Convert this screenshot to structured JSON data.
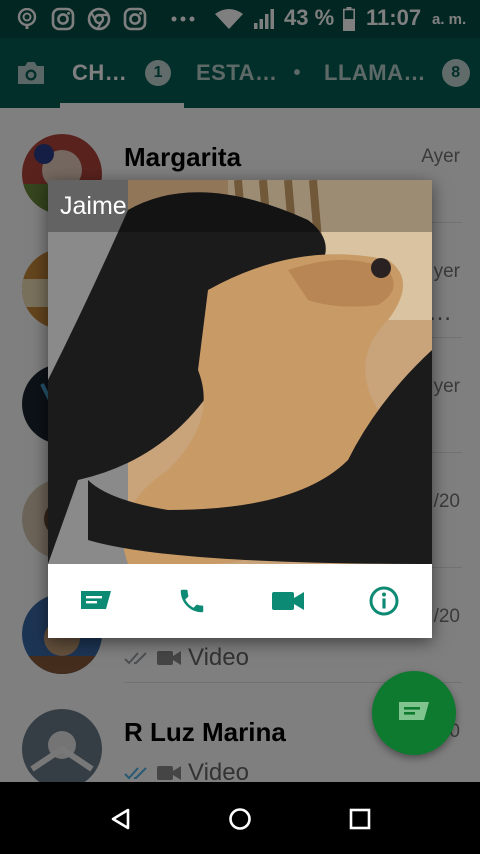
{
  "status_bar": {
    "battery_percent": "43 %",
    "time": "11:07",
    "ampm": "a. m.",
    "left_icons": [
      "radar-icon",
      "instagram-icon",
      "chrome-icon",
      "instagram-icon",
      "more-dots-icon"
    ],
    "right_icons": [
      "wifi-icon",
      "signal-icon",
      "battery-icon"
    ]
  },
  "tabs": [
    {
      "label": "CH…",
      "badge": "1",
      "active": true
    },
    {
      "label": "ESTA…",
      "badge": "•",
      "active": false
    },
    {
      "label": "LLAMA…",
      "badge": "8",
      "active": false
    }
  ],
  "chats": [
    {
      "name": "Margarita",
      "time": "Ayer",
      "preview": "",
      "ticks": false
    },
    {
      "name": "",
      "time": "yer",
      "preview": "…",
      "ticks": false
    },
    {
      "name": "",
      "time": "yer",
      "preview": "",
      "ticks": false
    },
    {
      "name": "",
      "time": "/20",
      "preview": "",
      "ticks": false
    },
    {
      "name": "",
      "time": "/20",
      "preview": "Video",
      "ticks": true,
      "ticks_color": "#9aa0a6"
    },
    {
      "name": "R Luz Marina",
      "time": "0",
      "preview": "Video",
      "ticks": true,
      "ticks_color": "#4fb3e8"
    }
  ],
  "popup": {
    "contact_name": "Jaime",
    "actions": [
      {
        "name": "message-icon",
        "color": "#0d8a74"
      },
      {
        "name": "phone-icon",
        "color": "#0d8a74"
      },
      {
        "name": "video-icon",
        "color": "#0d8a74"
      },
      {
        "name": "info-icon",
        "color": "#0d8a74"
      }
    ]
  },
  "fab": {
    "icon": "new-chat-icon",
    "color": "#0e7a2f"
  },
  "colors": {
    "header_dark": "#054d44",
    "header": "#075e54",
    "accent": "#0d8a74"
  },
  "navbar": {
    "icons": [
      "back-icon",
      "home-icon",
      "recents-icon"
    ]
  }
}
